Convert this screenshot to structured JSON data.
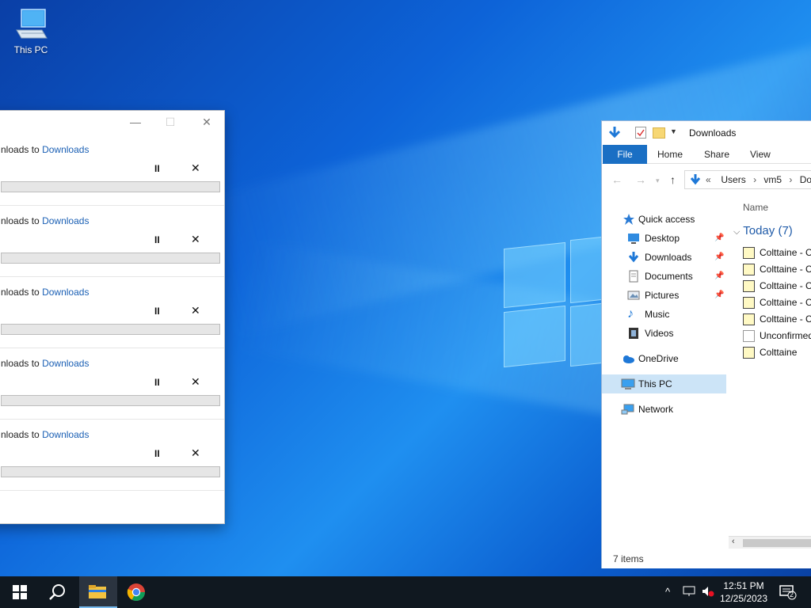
{
  "desktop": {
    "icons": [
      {
        "label": "This PC",
        "icon": "computer-icon"
      }
    ]
  },
  "downloads_window": {
    "items": [
      {
        "text_prefix": "nloads",
        "text_to": "to",
        "link": "Downloads"
      },
      {
        "text_prefix": "nloads",
        "text_to": "to",
        "link": "Downloads"
      },
      {
        "text_prefix": "nloads",
        "text_to": "to",
        "link": "Downloads"
      },
      {
        "text_prefix": "nloads",
        "text_to": "to",
        "link": "Downloads"
      },
      {
        "text_prefix": "nloads",
        "text_to": "to",
        "link": "Downloads"
      }
    ],
    "pause_label": "II",
    "cancel_label": "✕",
    "minimize_label": "—",
    "maximize_label": "☐",
    "close_label": "✕"
  },
  "explorer": {
    "title": "Downloads",
    "ribbon_tabs": [
      "File",
      "Home",
      "Share",
      "View"
    ],
    "address": {
      "prefix": "«",
      "segments": [
        "Users",
        "vm5",
        "Dow"
      ],
      "separator": "›"
    },
    "nav": {
      "quick_access": "Quick access",
      "items": [
        {
          "label": "Desktop",
          "pinned": true,
          "icon": "desktop-icon"
        },
        {
          "label": "Downloads",
          "pinned": true,
          "icon": "download-icon"
        },
        {
          "label": "Documents",
          "pinned": true,
          "icon": "document-icon"
        },
        {
          "label": "Pictures",
          "pinned": true,
          "icon": "pictures-icon"
        },
        {
          "label": "Music",
          "pinned": false,
          "icon": "music-icon"
        },
        {
          "label": "Videos",
          "pinned": false,
          "icon": "video-icon"
        }
      ],
      "onedrive": "OneDrive",
      "this_pc": "This PC",
      "network": "Network"
    },
    "column_name": "Name",
    "group_label": "Today (7)",
    "files": [
      {
        "name": "Colttaine - C",
        "icon": "zip-icon"
      },
      {
        "name": "Colttaine - C",
        "icon": "zip-icon"
      },
      {
        "name": "Colttaine - C",
        "icon": "zip-icon"
      },
      {
        "name": "Colttaine - C",
        "icon": "zip-icon"
      },
      {
        "name": "Colttaine - C",
        "icon": "zip-icon"
      },
      {
        "name": "Unconfirmed",
        "icon": "blank-file-icon"
      },
      {
        "name": "Colttaine",
        "icon": "zip-icon"
      }
    ],
    "status": "7 items"
  },
  "taskbar": {
    "time": "12:51 PM",
    "date": "12/25/2023",
    "notification_count": "2",
    "accent": "#76b9ed"
  }
}
